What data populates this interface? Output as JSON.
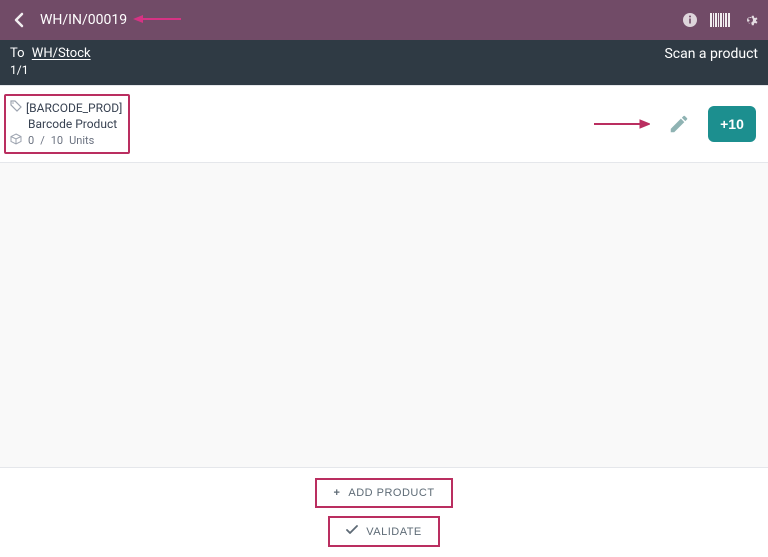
{
  "topbar": {
    "title": "WH/IN/00019"
  },
  "subbar": {
    "to_label": "To",
    "to_location": "WH/Stock",
    "count": "1/1",
    "scan_hint": "Scan a product"
  },
  "product": {
    "code": "[BARCODE_PROD]",
    "name": "Barcode Product",
    "qty_done": "0",
    "qty_sep": "/",
    "qty_total": "10",
    "qty_unit": "Units",
    "plus_label": "+10"
  },
  "actions": {
    "add_product": "ADD PRODUCT",
    "validate": "VALIDATE"
  },
  "icons": {
    "back": "chevron-left",
    "info": "info",
    "barcode": "barcode",
    "settings": "gear",
    "tag": "tag",
    "package": "package",
    "edit": "pencil",
    "add": "plus",
    "check": "check"
  },
  "colors": {
    "brand": "#714B67",
    "dark": "#2f3a44",
    "teal": "#1c8f8f",
    "highlight": "#ba2e60"
  }
}
